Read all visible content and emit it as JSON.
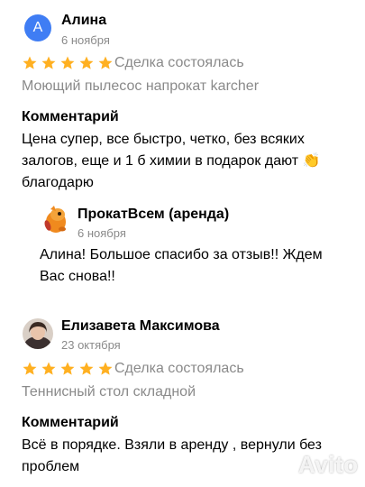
{
  "reviews": [
    {
      "avatar_letter": "А",
      "name": "Алина",
      "date": "6 ноября",
      "stars": 5,
      "status": "Сделка состоялась",
      "item": "Моющий пылесос напрокат karcher",
      "comment_heading": "Комментарий",
      "comment_lines": [
        "Цена супер, все быстро, четко, без всяких",
        "залогов, еще и 1 б химии в подарок дают 👏",
        "благодарю"
      ],
      "reply": {
        "name": "ПрокатВсем (аренда)",
        "date": "6 ноября",
        "lines": [
          "Алина! Большое спасибо за отзыв!! Ждем",
          "Вас снова!!"
        ]
      }
    },
    {
      "name": "Елизавета Максимова",
      "date": "23 октября",
      "stars": 5,
      "status": "Сделка состоялась",
      "item": "Теннисный стол складной",
      "comment_heading": "Комментарий",
      "comment_lines": [
        "Всё в порядке. Взяли в аренду , вернули без",
        "проблем"
      ]
    }
  ],
  "watermark": "Avito",
  "colors": {
    "star": "#ffb021",
    "avatar": "#3f7df4",
    "muted": "#8a8a8a"
  }
}
